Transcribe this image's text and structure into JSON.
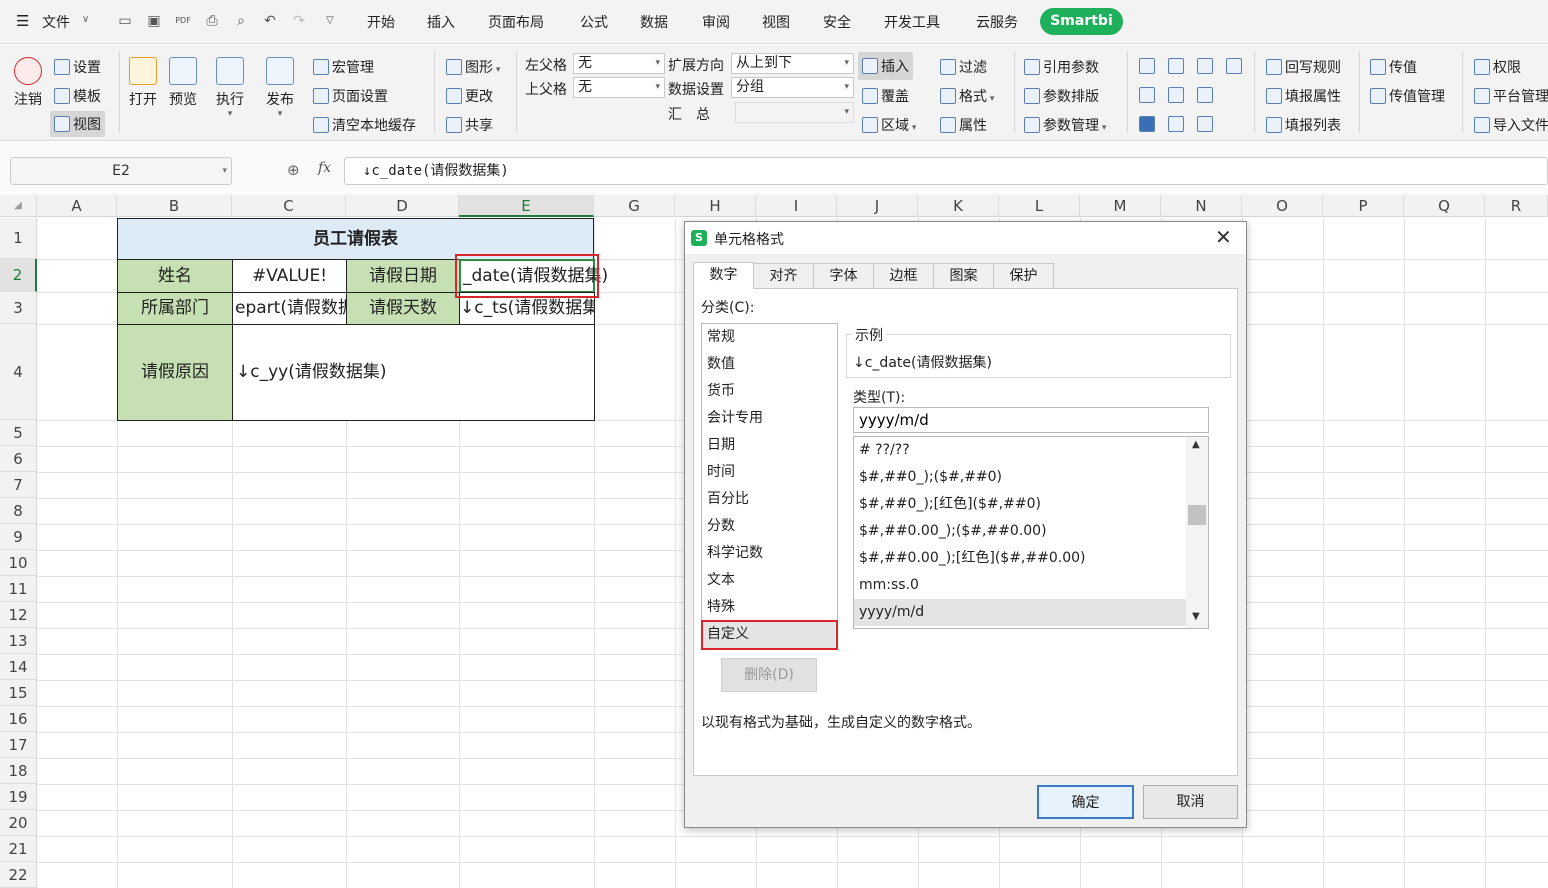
{
  "menu": {
    "file": "文件",
    "tabs": [
      "开始",
      "插入",
      "页面布局",
      "公式",
      "数据",
      "审阅",
      "视图",
      "安全",
      "开发工具",
      "云服务"
    ],
    "brand": "Smartbi"
  },
  "ribbon": {
    "logout": "注销",
    "settings": "设置",
    "template": "模板",
    "view": "视图",
    "open": "打开",
    "preview": "预览",
    "execute": "执行",
    "publish": "发布",
    "macro": "宏管理",
    "page_setup": "页面设置",
    "clear_cache": "清空本地缓存",
    "chart": "图形",
    "change": "更改",
    "share": "共享",
    "left_parent_label": "左父格",
    "left_parent_value": "无",
    "top_parent_label": "上父格",
    "top_parent_value": "无",
    "expand_dir_label": "扩展方向",
    "expand_dir_value": "从上到下",
    "data_setting_label": "数据设置",
    "data_setting_value": "分组",
    "summary_label": "汇　总",
    "insert": "插入",
    "cover": "覆盖",
    "region": "区域",
    "filter": "过滤",
    "format": "格式",
    "property": "属性",
    "ref_param": "引用参数",
    "param_layout": "参数排版",
    "param_manage": "参数管理",
    "writeback_rule": "回写规则",
    "fill_property": "填报属性",
    "fill_list": "填报列表",
    "pass_value": "传值",
    "pass_value_manage": "传值管理",
    "permission": "权限",
    "platform_manage": "平台管理",
    "import_file": "导入文件"
  },
  "formula": {
    "cell_ref": "E2",
    "fx": "fx",
    "value": "↓c_date(请假数据集)"
  },
  "columns": [
    "A",
    "B",
    "C",
    "D",
    "E",
    "G",
    "H",
    "I",
    "J",
    "K",
    "L",
    "M",
    "N",
    "O",
    "P",
    "Q",
    "R"
  ],
  "rows": [
    "1",
    "2",
    "3",
    "4",
    "5",
    "6",
    "7",
    "8",
    "9",
    "10",
    "11",
    "12",
    "13",
    "14",
    "15",
    "16",
    "17",
    "18",
    "19",
    "20",
    "21",
    "22"
  ],
  "sheet": {
    "title": "员工请假表",
    "name_label": "姓名",
    "name_value": "#VALUE!",
    "date_label": "请假日期",
    "date_value": "_date(请假数据集)",
    "dept_label": "所属部门",
    "dept_value": "epart(请假数据",
    "days_label": "请假天数",
    "days_value": "↓c_ts(请假数据集)",
    "reason_label": "请假原因",
    "reason_value": "↓c_yy(请假数据集)"
  },
  "dialog": {
    "title": "单元格格式",
    "tabs": [
      "数字",
      "对齐",
      "字体",
      "边框",
      "图案",
      "保护"
    ],
    "category_label": "分类(C):",
    "categories": [
      "常规",
      "数值",
      "货币",
      "会计专用",
      "日期",
      "时间",
      "百分比",
      "分数",
      "科学记数",
      "文本",
      "特殊",
      "自定义"
    ],
    "sample_label": "示例",
    "sample_value": "↓c_date(请假数据集)",
    "type_label": "类型(T):",
    "type_value": "yyyy/m/d",
    "formats": [
      "# ??/??",
      "$#,##0_);($#,##0)",
      "$#,##0_);[红色]($#,##0)",
      "$#,##0.00_);($#,##0.00)",
      "$#,##0.00_);[红色]($#,##0.00)",
      "mm:ss.0",
      "yyyy/m/d"
    ],
    "delete": "删除(D)",
    "hint": "以现有格式为基础，生成自定义的数字格式。",
    "ok": "确定",
    "cancel": "取消"
  },
  "colors": {
    "accent": "#1eb05b",
    "highlight_border": "#d9262c",
    "header_green": "#c6e0b4",
    "title_blue": "#ddebf7"
  }
}
